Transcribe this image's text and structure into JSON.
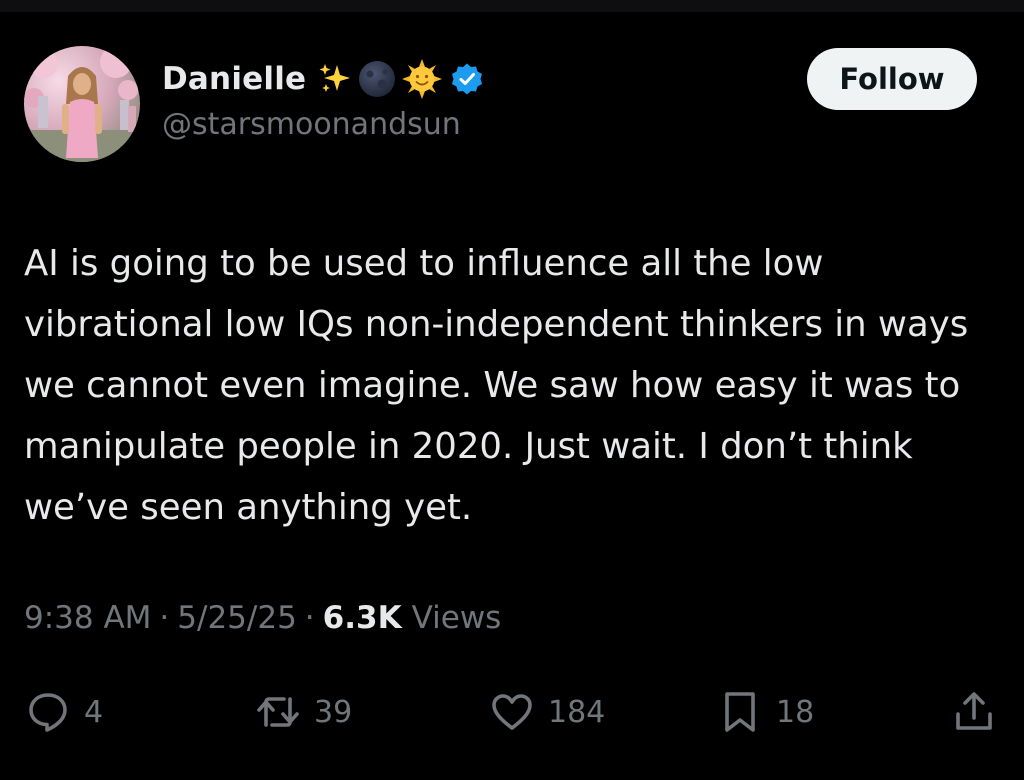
{
  "user": {
    "display_name": "Danielle",
    "handle": "@starsmoonandsun",
    "name_emojis": [
      "sparkles-icon",
      "new-moon-face-icon",
      "sun-face-icon"
    ],
    "verified": true
  },
  "follow_button": {
    "label": "Follow"
  },
  "tweet": {
    "text": "AI is going to be used to influence all the low vibrational low IQs non-independent thinkers in ways we cannot even imagine. We saw how easy it was to manipulate people in 2020. Just wait. I don’t think we’ve seen anything yet."
  },
  "meta": {
    "time": "9:38 AM",
    "separator": "·",
    "date": "5/25/25",
    "views_count": "6.3K",
    "views_label": "Views"
  },
  "actions": {
    "replies": "4",
    "reposts": "39",
    "likes": "184",
    "bookmarks": "18"
  },
  "colors": {
    "background": "#000000",
    "text_primary": "#e7e9ea",
    "text_secondary": "#71767b",
    "verified_blue": "#1d9bf0",
    "follow_bg": "#eff3f4"
  }
}
